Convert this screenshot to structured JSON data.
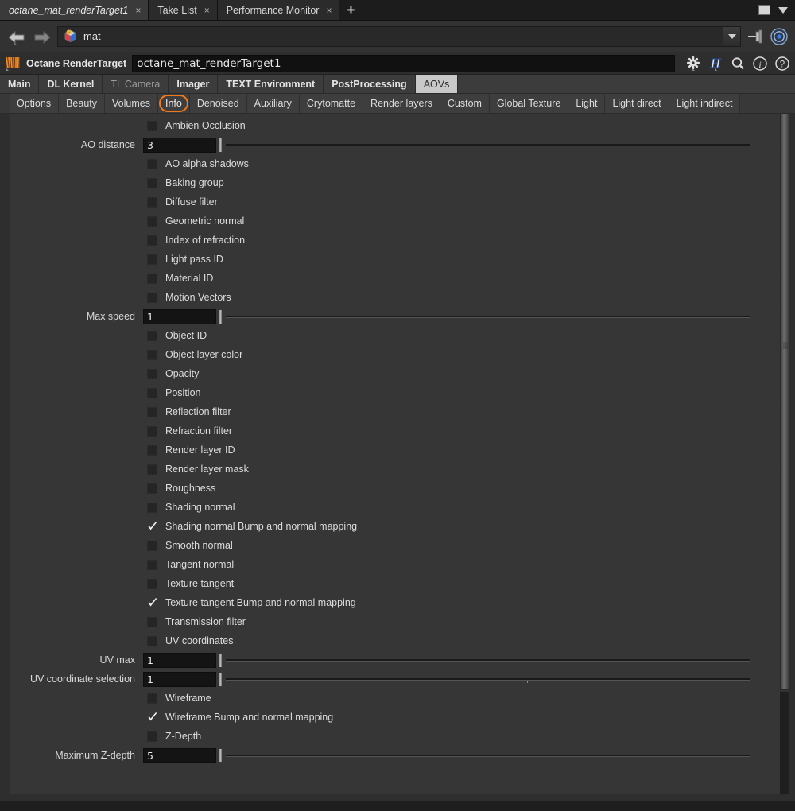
{
  "window_tabs": {
    "tabs": [
      {
        "label": "octane_mat_renderTarget1",
        "close": "×",
        "active": true
      },
      {
        "label": "Take List",
        "close": "×",
        "active": false
      },
      {
        "label": "Performance Monitor",
        "close": "×",
        "active": false
      }
    ],
    "add_label": "+",
    "maximize_name": "maximize-box",
    "menu_name": "window-menu-caret"
  },
  "path_bar": {
    "back_name": "back-arrow",
    "forward_name": "forward-arrow",
    "path_value": "mat",
    "path_icon": "material-node-icon",
    "dropdown_name": "path-dropdown",
    "pin_name": "pin-icon",
    "target_name": "target-icon"
  },
  "node_header": {
    "icon_name": "octane-icon",
    "type_label": "Octane RenderTarget",
    "name_value": "octane_mat_renderTarget1",
    "icons": [
      {
        "name": "gear-icon",
        "glyph": "⚙"
      },
      {
        "name": "houdini-h-icon",
        "glyph": "H"
      },
      {
        "name": "search-icon",
        "glyph": "⚲"
      },
      {
        "name": "info-icon",
        "glyph": "i"
      },
      {
        "name": "help-icon",
        "glyph": "?"
      }
    ]
  },
  "main_tabs": [
    {
      "label": "Main",
      "state": "normal"
    },
    {
      "label": "DL Kernel",
      "state": "normal"
    },
    {
      "label": "TL Camera",
      "state": "dim"
    },
    {
      "label": "Imager",
      "state": "normal"
    },
    {
      "label": "TEXT Environment",
      "state": "normal"
    },
    {
      "label": "PostProcessing",
      "state": "normal"
    },
    {
      "label": "AOVs",
      "state": "active"
    }
  ],
  "sub_tabs": [
    {
      "label": "Options",
      "highlighted": false
    },
    {
      "label": "Beauty",
      "highlighted": false
    },
    {
      "label": "Volumes",
      "highlighted": false
    },
    {
      "label": "Info",
      "highlighted": true
    },
    {
      "label": "Denoised",
      "highlighted": false
    },
    {
      "label": "Auxiliary",
      "highlighted": false
    },
    {
      "label": "Crytomatte",
      "highlighted": false
    },
    {
      "label": "Render layers",
      "highlighted": false
    },
    {
      "label": "Custom",
      "highlighted": false
    },
    {
      "label": "Global Texture",
      "highlighted": false
    },
    {
      "label": "Light",
      "highlighted": false
    },
    {
      "label": "Light direct",
      "highlighted": false
    },
    {
      "label": "Light indirect",
      "highlighted": false
    }
  ],
  "highlight_color": "#f07818",
  "rows": [
    {
      "type": "checkbox",
      "label": "Ambien Occlusion",
      "checked": false
    },
    {
      "type": "slider",
      "label": "AO distance",
      "value": "3",
      "tick": null
    },
    {
      "type": "checkbox",
      "label": "AO alpha shadows",
      "checked": false
    },
    {
      "type": "checkbox",
      "label": "Baking group",
      "checked": false
    },
    {
      "type": "checkbox",
      "label": "Diffuse filter",
      "checked": false
    },
    {
      "type": "checkbox",
      "label": "Geometric normal",
      "checked": false
    },
    {
      "type": "checkbox",
      "label": "Index of refraction",
      "checked": false
    },
    {
      "type": "checkbox",
      "label": "Light pass ID",
      "checked": false
    },
    {
      "type": "checkbox",
      "label": "Material ID",
      "checked": false
    },
    {
      "type": "checkbox",
      "label": "Motion Vectors",
      "checked": false
    },
    {
      "type": "slider",
      "label": "Max speed",
      "value": "1",
      "tick": null
    },
    {
      "type": "checkbox",
      "label": "Object ID",
      "checked": false
    },
    {
      "type": "checkbox",
      "label": "Object layer color",
      "checked": false
    },
    {
      "type": "checkbox",
      "label": "Opacity",
      "checked": false
    },
    {
      "type": "checkbox",
      "label": "Position",
      "checked": false
    },
    {
      "type": "checkbox",
      "label": "Reflection filter",
      "checked": false
    },
    {
      "type": "checkbox",
      "label": "Refraction filter",
      "checked": false
    },
    {
      "type": "checkbox",
      "label": "Render layer ID",
      "checked": false
    },
    {
      "type": "checkbox",
      "label": "Render layer mask",
      "checked": false
    },
    {
      "type": "checkbox",
      "label": "Roughness",
      "checked": false
    },
    {
      "type": "checkbox",
      "label": "Shading normal",
      "checked": false
    },
    {
      "type": "checkbox",
      "label": "Shading normal Bump and normal mapping",
      "checked": true
    },
    {
      "type": "checkbox",
      "label": "Smooth normal",
      "checked": false
    },
    {
      "type": "checkbox",
      "label": "Tangent normal",
      "checked": false
    },
    {
      "type": "checkbox",
      "label": "Texture tangent",
      "checked": false
    },
    {
      "type": "checkbox",
      "label": "Texture tangent Bump and normal mapping",
      "checked": true
    },
    {
      "type": "checkbox",
      "label": "Transmission filter",
      "checked": false
    },
    {
      "type": "checkbox",
      "label": "UV coordinates",
      "checked": false
    },
    {
      "type": "slider",
      "label": "UV max",
      "value": "1",
      "tick": null
    },
    {
      "type": "slider",
      "label": "UV coordinate selection",
      "value": "1",
      "tick": 58
    },
    {
      "type": "checkbox",
      "label": "Wireframe",
      "checked": false
    },
    {
      "type": "checkbox",
      "label": "Wireframe Bump and normal mapping",
      "checked": true
    },
    {
      "type": "checkbox",
      "label": "Z-Depth",
      "checked": false
    },
    {
      "type": "slider",
      "label": "Maximum Z-depth",
      "value": "5",
      "tick": null
    }
  ]
}
